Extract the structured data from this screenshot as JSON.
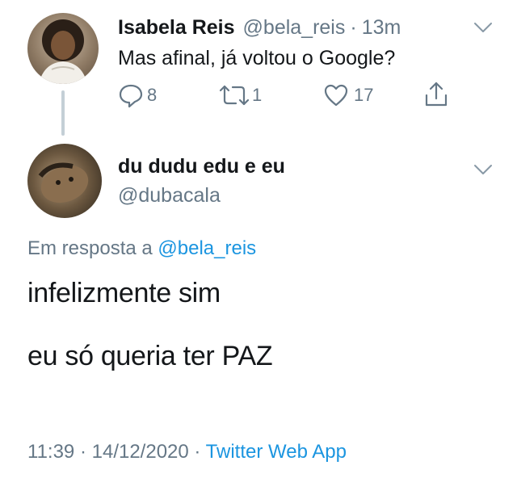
{
  "parent_tweet": {
    "display_name": "Isabela Reis",
    "handle": "@bela_reis",
    "separator": "·",
    "time_ago": "13m",
    "text": "Mas afinal, já voltou o Google?",
    "actions": {
      "reply_count": "8",
      "retweet_count": "1",
      "like_count": "17"
    }
  },
  "reply_tweet": {
    "display_name": "du dudu edu e eu",
    "handle": "@dubacala",
    "replying_to_prefix": "Em resposta a",
    "replying_to_handle": "@bela_reis",
    "line1": "infelizmente sim",
    "line2": "eu só queria ter PAZ",
    "time": "11:39",
    "dot1": "·",
    "date": "14/12/2020",
    "dot2": "·",
    "source": "Twitter Web App"
  },
  "colors": {
    "text": "#14171a",
    "secondary": "#657786",
    "link": "#1b95e0",
    "thread_line": "#c4cfd6"
  },
  "icons": [
    "chevron-down-icon",
    "reply-icon",
    "retweet-icon",
    "like-icon",
    "share-icon"
  ]
}
